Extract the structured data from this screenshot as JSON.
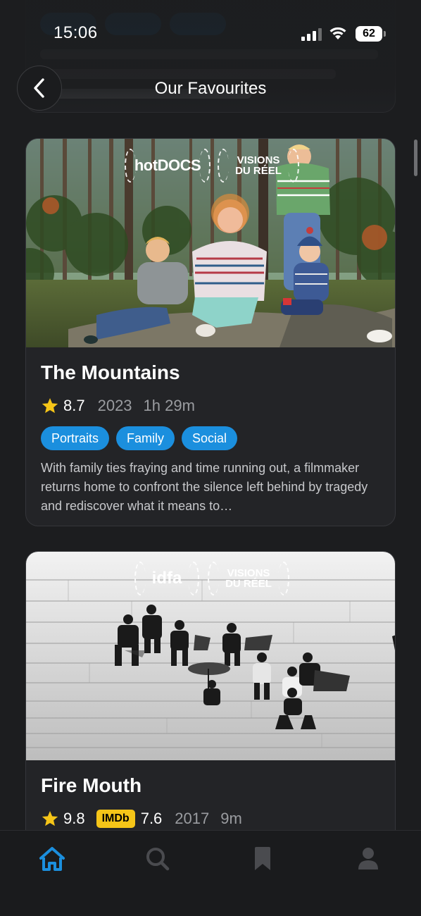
{
  "status_bar": {
    "time": "15:06",
    "battery": "62"
  },
  "nav": {
    "title": "Our Favourites"
  },
  "films": [
    {
      "title": "The Mountains",
      "rating": "8.7",
      "year": "2023",
      "duration": "1h 29m",
      "tags": [
        "Portraits",
        "Family",
        "Social"
      ],
      "description": "With family ties fraying and time running out, a filmmaker returns home to confront the silence left behind by tragedy and rediscover what it means to…",
      "festival_laurels": [
        "hotDOCS",
        "VISIONS DU RÉEL"
      ]
    },
    {
      "title": "Fire Mouth",
      "rating": "9.8",
      "imdb_label": "IMDb",
      "imdb_rating": "7.6",
      "year": "2017",
      "duration": "9m",
      "festival_laurels": [
        "idfa",
        "VISIONS DU RÉEL"
      ]
    }
  ],
  "tab_bar": [
    {
      "name": "home-icon",
      "active": true
    },
    {
      "name": "search-icon",
      "active": false
    },
    {
      "name": "bookmark-icon",
      "active": false
    },
    {
      "name": "profile-icon",
      "active": false
    }
  ],
  "colors": {
    "background": "#1c1d1f",
    "card": "#232427",
    "accent": "#1b8fde",
    "star": "#f5c518",
    "imdb": "#f5c518"
  }
}
